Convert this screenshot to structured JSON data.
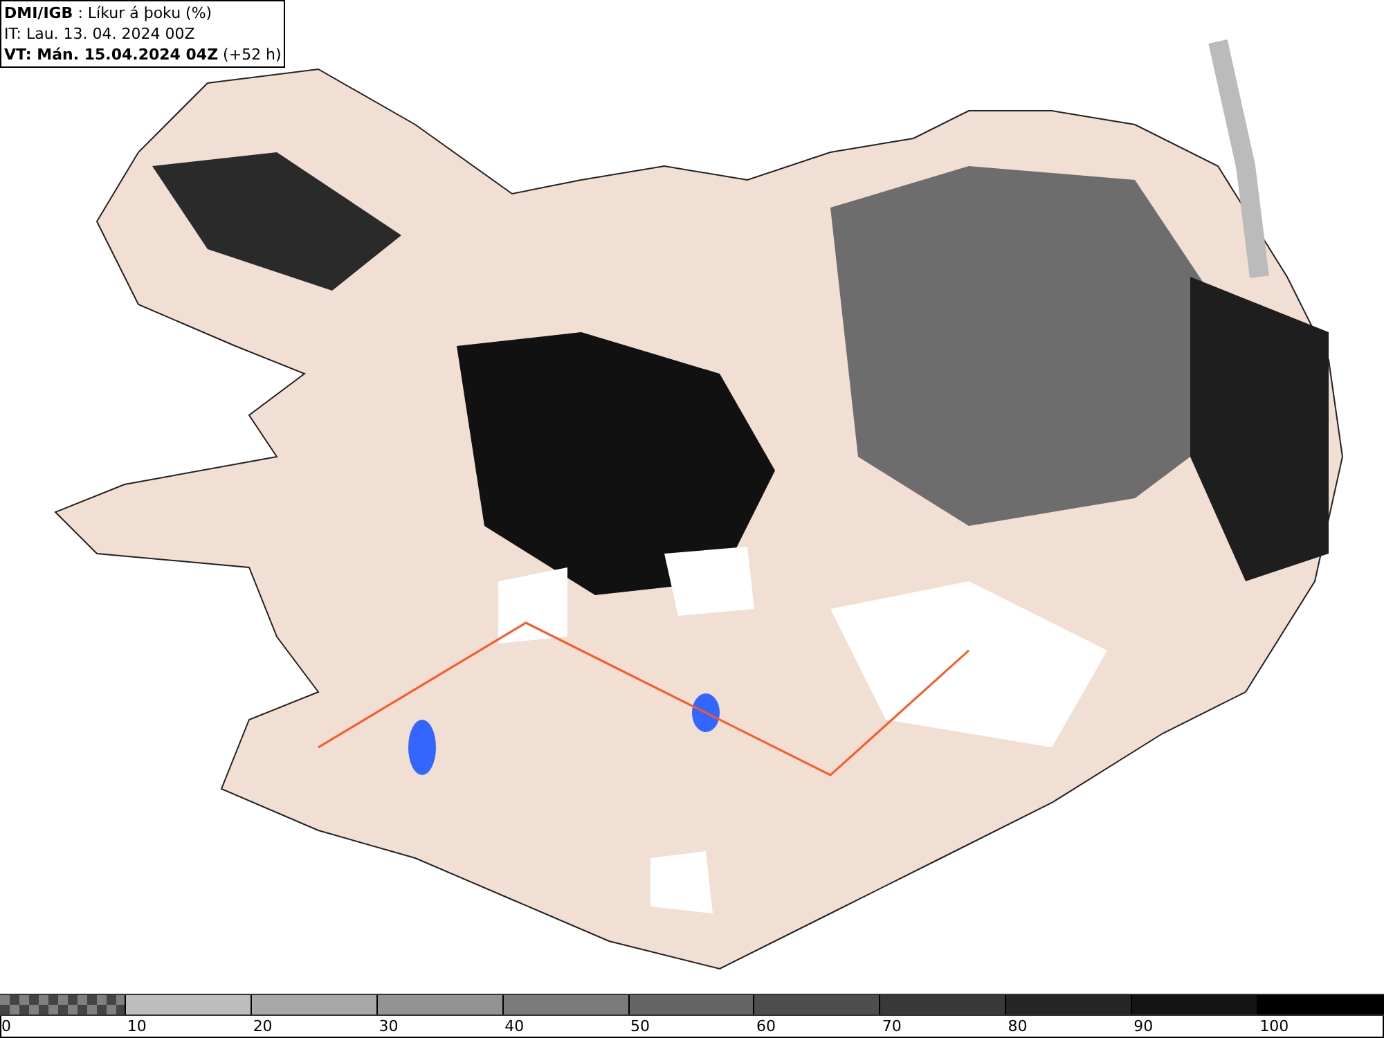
{
  "header": {
    "lines": [
      "**DMI/IGB** : Líkur á þoku (%)",
      "IT: Lau. 13. 04. 2024 00Z",
      "**VT: Mán. 15.04.2024 04Z** (+52 h)"
    ]
  },
  "legend": {
    "swatches": [
      {
        "kind": "checker",
        "color": "#808080"
      },
      {
        "kind": "solid",
        "color": "#bdbdbd"
      },
      {
        "kind": "solid",
        "color": "#a8a8a8"
      },
      {
        "kind": "solid",
        "color": "#939393"
      },
      {
        "kind": "solid",
        "color": "#7a7a7a"
      },
      {
        "kind": "solid",
        "color": "#646464"
      },
      {
        "kind": "solid",
        "color": "#4e4e4e"
      },
      {
        "kind": "solid",
        "color": "#393939"
      },
      {
        "kind": "solid",
        "color": "#262626"
      },
      {
        "kind": "solid",
        "color": "#141414"
      },
      {
        "kind": "solid",
        "color": "#000000"
      }
    ],
    "labels": [
      "0",
      "10",
      "20",
      "30",
      "40",
      "50",
      "60",
      "70",
      "80",
      "90",
      "100"
    ]
  }
}
